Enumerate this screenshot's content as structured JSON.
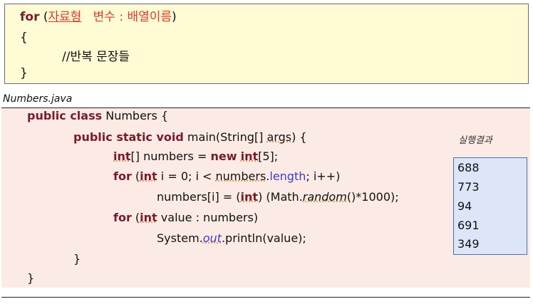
{
  "syntax": {
    "line1_for": "for",
    "line1_open": " (",
    "line1_type": "자료형",
    "line1_rest": "   변수 : 배열이름",
    "line1_close": ")",
    "line2": "{",
    "line3": "//반복 문장들",
    "line4": "}"
  },
  "file": {
    "name": "Numbers.java"
  },
  "code": {
    "l1_kw": "public class",
    "l1_rest": " Numbers {",
    "l2_kw": "public static void",
    "l2_rest": " main(String[] ",
    "l2_args": "args",
    "l2_end": ") {",
    "l3_int": "int",
    "l3_a": "[] numbers = ",
    "l3_new": "new",
    "l3_sp": " ",
    "l3_int2": "int",
    "l3_end": "[5];",
    "l4_for": "for",
    "l4_a": " (",
    "l4_int": "int",
    "l4_b": " i = 0; i < ",
    "l4_numbers": "numbers",
    "l4_dot": ".",
    "l4_length": "length",
    "l4_end": "; i++)",
    "l5_a": "numbers[i] = (",
    "l5_int": "int",
    "l5_b": ") (Math.",
    "l5_random": "random",
    "l5_end": "()*1000);",
    "l6_for": "for",
    "l6_a": " (",
    "l6_int": "int",
    "l6_end": " value : numbers)",
    "l7_a": "System.",
    "l7_out": "out",
    "l7_end": ".println(value);",
    "l8": "}",
    "l9": "}"
  },
  "result": {
    "label": "실행결과",
    "values": [
      "688",
      "773",
      "94",
      "691",
      "349"
    ]
  }
}
